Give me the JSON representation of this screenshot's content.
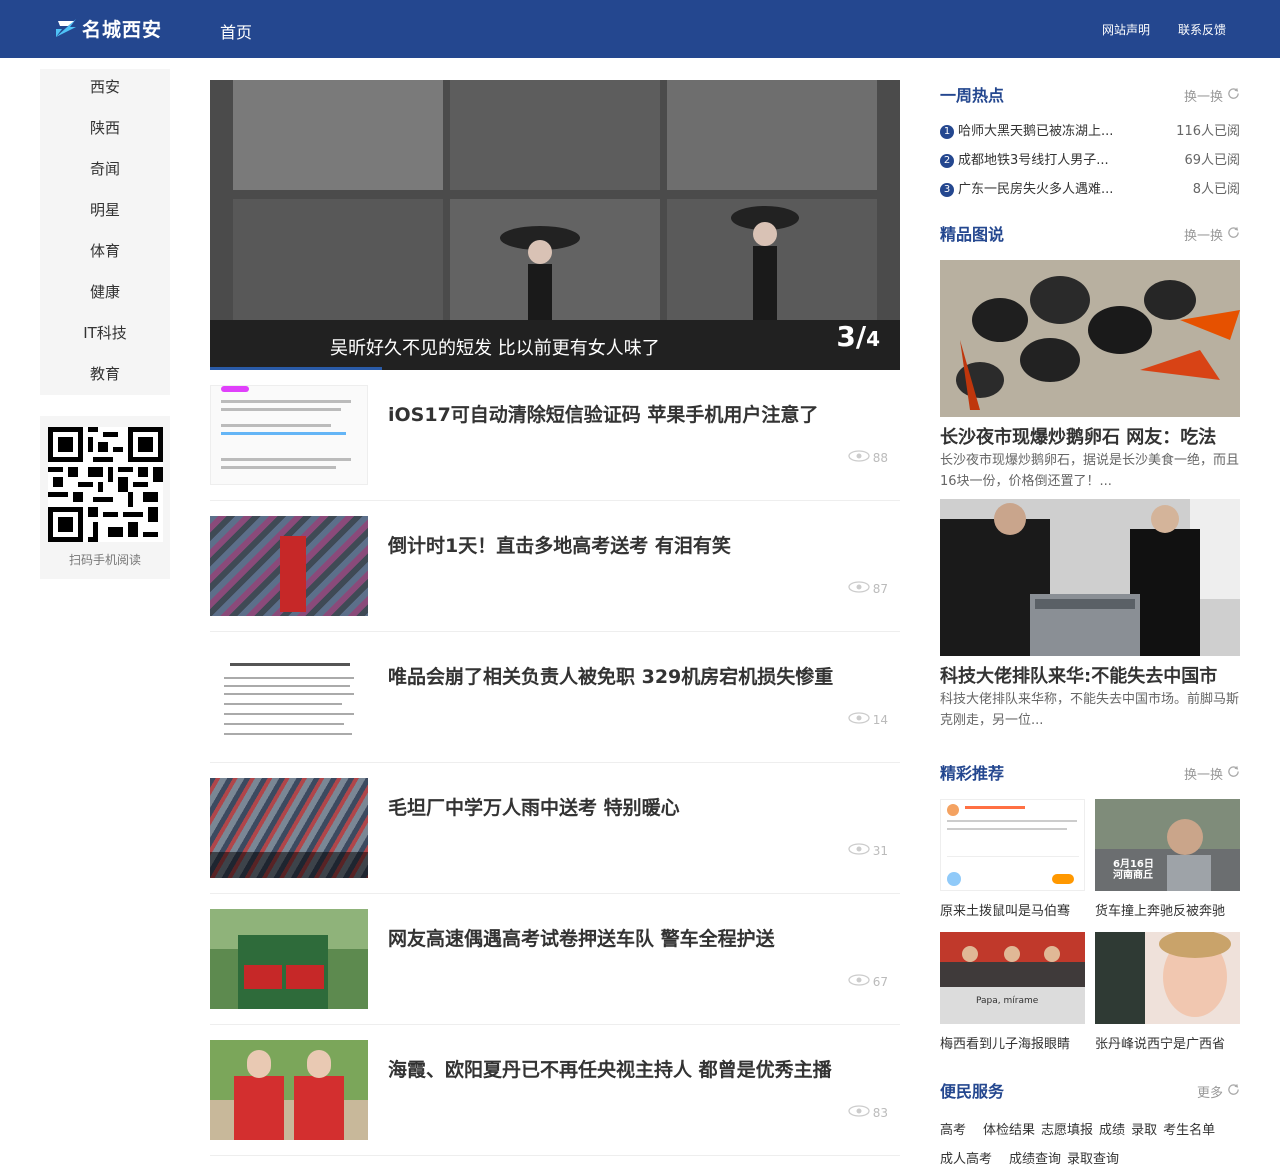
{
  "header": {
    "logo_text": "名城西安",
    "nav_home": "首页",
    "links": [
      "网站声明",
      "联系反馈"
    ]
  },
  "sidebar": {
    "categories": [
      "西安",
      "陕西",
      "奇闻",
      "明星",
      "体育",
      "健康",
      "IT科技",
      "教育"
    ],
    "qr_caption": "扫码手机阅读"
  },
  "slider": {
    "caption": "吴昕好久不见的短发 比以前更有女人味了",
    "current": "3",
    "total": "4"
  },
  "news": [
    {
      "title": "iOS17可自动清除短信验证码 苹果手机用户注意了",
      "views": "88"
    },
    {
      "title": "倒计时1天！直击多地高考送考 有泪有笑",
      "views": "87"
    },
    {
      "title": "唯品会崩了相关负责人被免职 329机房宕机损失惨重",
      "views": "14"
    },
    {
      "title": "毛坦厂中学万人雨中送考 特别暖心",
      "views": "31"
    },
    {
      "title": "网友高速偶遇高考试卷押送车队 警车全程护送",
      "views": "67"
    },
    {
      "title": "海霞、欧阳夏丹已不再任央视主持人 都曾是优秀主播",
      "views": "83"
    }
  ],
  "weekly_hot": {
    "heading": "一周热点",
    "refresh": "换一换",
    "items": [
      {
        "num": "1",
        "title": "哈师大黑天鹅已被冻湖上...",
        "reads": "116人已阅"
      },
      {
        "num": "2",
        "title": "成都地铁3号线打人男子...",
        "reads": "69人已阅"
      },
      {
        "num": "3",
        "title": "广东一民房失火多人遇难...",
        "reads": "8人已阅"
      }
    ]
  },
  "picture_talk": {
    "heading": "精品图说",
    "refresh": "换一换",
    "items": [
      {
        "title": "长沙夜市现爆炒鹅卵石 网友：吃法",
        "desc": "长沙夜市现爆炒鹅卵石，据说是长沙美食一绝，而且16块一份，价格倒还置了！..."
      },
      {
        "title": "科技大佬排队来华:不能失去中国市",
        "desc": " 科技大佬排队来华称，不能失去中国市场。前脚马斯克刚走，另一位..."
      }
    ]
  },
  "recommend": {
    "heading": "精彩推荐",
    "refresh": "换一换",
    "items": [
      {
        "caption": "原来土拨鼠叫是马伯骞"
      },
      {
        "caption": "货车撞上奔驰反被奔驰"
      },
      {
        "caption": "梅西看到儿子海报眼睛"
      },
      {
        "caption": "张丹峰说西宁是广西省"
      }
    ],
    "overlay_date": "6月16日",
    "overlay_place": "河南商丘",
    "poster_text": "Papa, mírame"
  },
  "services": {
    "heading": "便民服务",
    "more": "更多",
    "row1": [
      "高考",
      "体检结果",
      "志愿填报",
      "成绩",
      "录取",
      "考生名单"
    ],
    "row2": [
      "成人高考",
      "成绩查询",
      "录取查询"
    ]
  },
  "colors": {
    "brand": "#24478f",
    "accent": "#1e88e5"
  }
}
